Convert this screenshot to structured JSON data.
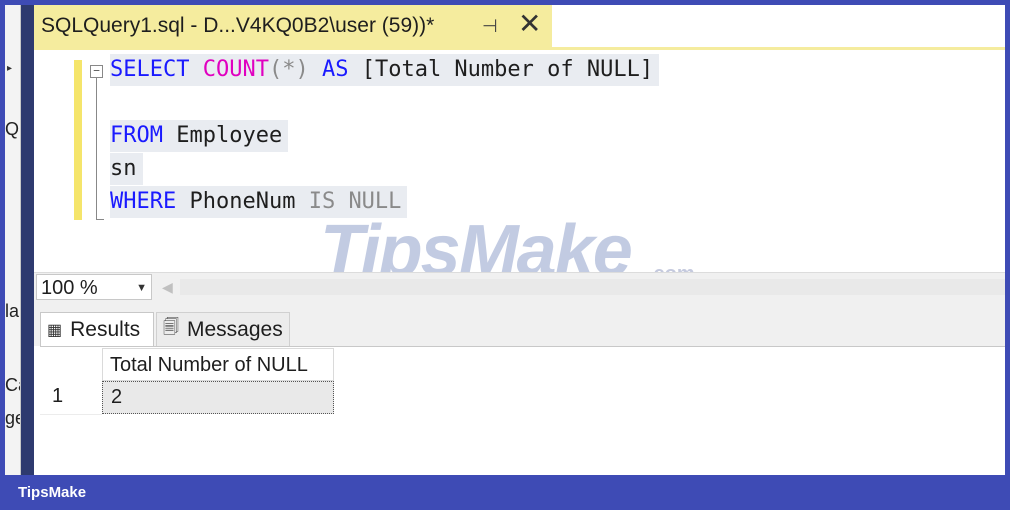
{
  "left_strip": {
    "fragments": [
      "QL",
      "la",
      "Ca",
      "ge"
    ]
  },
  "tab": {
    "title": "SQLQuery1.sql - D...V4KQ0B2\\user (59))*",
    "pin_glyph": "⊣",
    "close_glyph": "✕"
  },
  "code": {
    "line1": {
      "kw1": "SELECT",
      "fn": "COUNT",
      "args": "(*)",
      "kw2": "AS",
      "alias": "[Total Number of NULL]"
    },
    "line2": {
      "kw": "FROM",
      "table": "Employee"
    },
    "line3": {
      "text": "sn"
    },
    "line4": {
      "kw": "WHERE",
      "col": "PhoneNum",
      "rest": "IS NULL"
    }
  },
  "watermark": {
    "main": "TipsMake",
    "suffix": ".com"
  },
  "zoom": {
    "value": "100 %"
  },
  "results_tabs": [
    {
      "label": "Results",
      "icon": "grid-icon"
    },
    {
      "label": "Messages",
      "icon": "messages-icon"
    }
  ],
  "grid": {
    "columns": [
      "Total Number of NULL"
    ],
    "rows": [
      {
        "num": "1",
        "values": [
          "2"
        ]
      }
    ]
  },
  "footer": {
    "brand": "TipsMake"
  },
  "colors": {
    "frame": "#3e4bb5",
    "tab_active": "#f5ec9e",
    "keyword": "#1a1aff",
    "function": "#e000c0"
  }
}
